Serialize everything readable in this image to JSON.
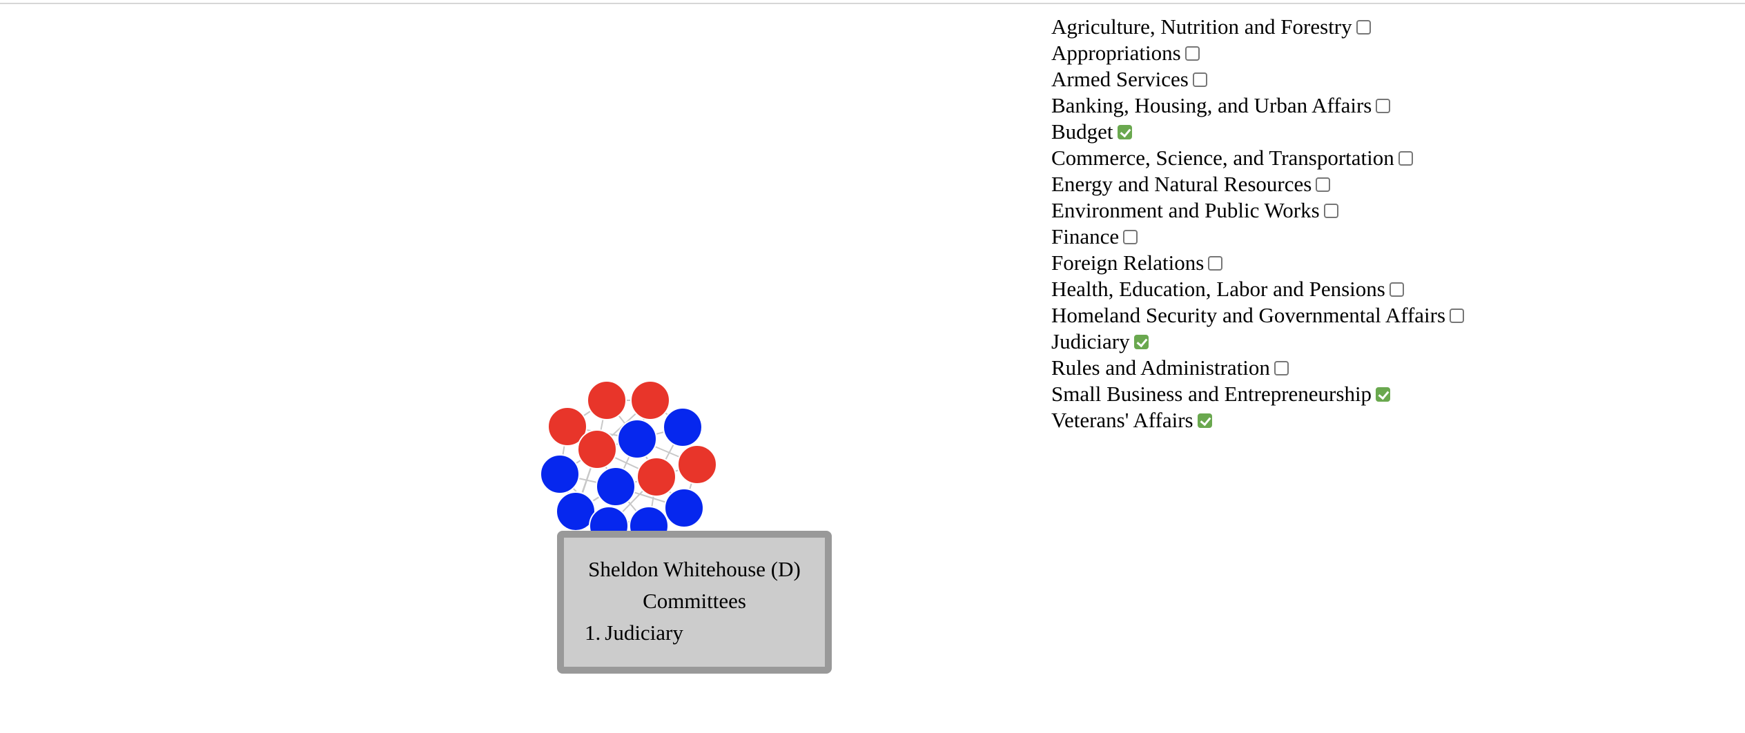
{
  "colors": {
    "republican": "#e8352a",
    "democrat": "#0627ee",
    "checked": "#6aa84f",
    "tooltip_bg": "#cccccc",
    "tooltip_border": "#999999",
    "link": "#c8c8c8"
  },
  "committees": [
    {
      "label": "Agriculture, Nutrition and Forestry",
      "checked": false
    },
    {
      "label": "Appropriations",
      "checked": false
    },
    {
      "label": "Armed Services",
      "checked": false
    },
    {
      "label": "Banking, Housing, and Urban Affairs",
      "checked": false
    },
    {
      "label": "Budget",
      "checked": true
    },
    {
      "label": "Commerce, Science, and Transportation",
      "checked": false
    },
    {
      "label": "Energy and Natural Resources",
      "checked": false
    },
    {
      "label": "Environment and Public Works",
      "checked": false
    },
    {
      "label": "Finance",
      "checked": false
    },
    {
      "label": "Foreign Relations",
      "checked": false
    },
    {
      "label": "Health, Education, Labor and Pensions",
      "checked": false
    },
    {
      "label": "Homeland Security and Governmental Affairs",
      "checked": false
    },
    {
      "label": "Judiciary",
      "checked": true
    },
    {
      "label": "Rules and Administration",
      "checked": false
    },
    {
      "label": "Small Business and Entrepreneurship",
      "checked": true
    },
    {
      "label": "Veterans' Affairs",
      "checked": true
    }
  ],
  "graph": {
    "nodes": [
      {
        "party": "R"
      },
      {
        "party": "R"
      },
      {
        "party": "R"
      },
      {
        "party": "D"
      },
      {
        "party": "R"
      },
      {
        "party": "D"
      },
      {
        "party": "R"
      },
      {
        "party": "D"
      },
      {
        "party": "R"
      },
      {
        "party": "D"
      },
      {
        "party": "R"
      },
      {
        "party": "D"
      },
      {
        "party": "D"
      },
      {
        "party": "D"
      },
      {
        "party": "D"
      }
    ]
  },
  "tooltip": {
    "name": "Sheldon Whitehouse (D)",
    "heading": "Committees",
    "items": [
      {
        "num": "1.",
        "label": "Judiciary"
      }
    ]
  }
}
